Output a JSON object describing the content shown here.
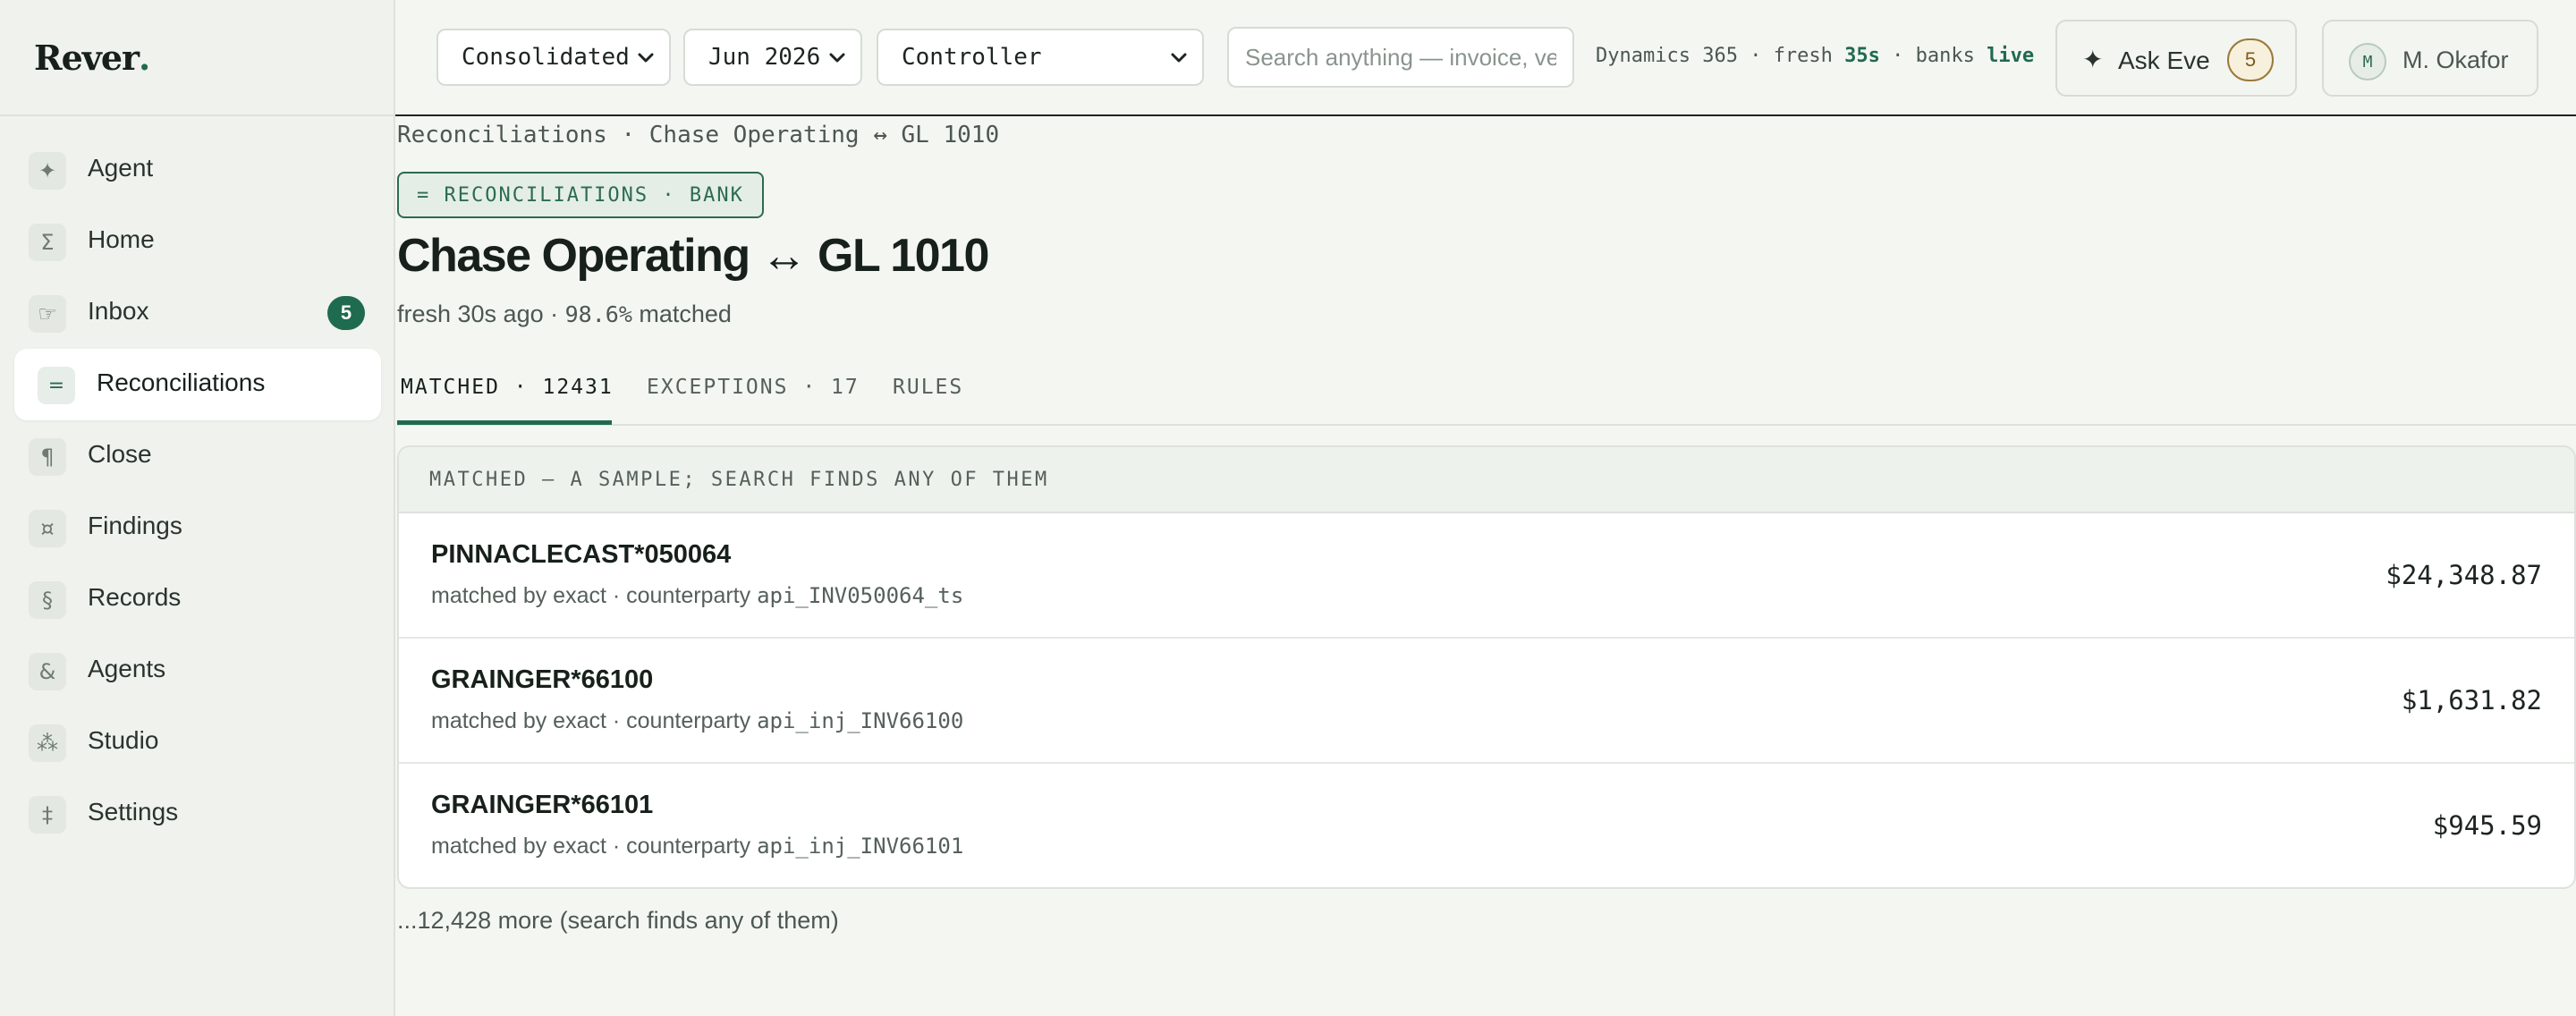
{
  "brand": {
    "name": "Rever",
    "dot": "."
  },
  "sidebar": {
    "items": [
      {
        "label": "Agent",
        "icon": "agent-icon",
        "glyph": "✦"
      },
      {
        "label": "Home",
        "icon": "sigma-icon",
        "glyph": "Σ"
      },
      {
        "label": "Inbox",
        "icon": "inbox-icon",
        "glyph": "☞",
        "badge": "5"
      },
      {
        "label": "Reconciliations",
        "icon": "equals-icon",
        "glyph": "=",
        "active": true
      },
      {
        "label": "Close",
        "icon": "pilcrow-icon",
        "glyph": "¶"
      },
      {
        "label": "Findings",
        "icon": "currency-icon",
        "glyph": "¤"
      },
      {
        "label": "Records",
        "icon": "section-icon",
        "glyph": "§"
      },
      {
        "label": "Agents",
        "icon": "ampersand-icon",
        "glyph": "&"
      },
      {
        "label": "Studio",
        "icon": "studio-icon",
        "glyph": "⁂"
      },
      {
        "label": "Settings",
        "icon": "double-dagger-icon",
        "glyph": "‡"
      }
    ]
  },
  "topbar": {
    "entity": "Consolidated",
    "period": "Jun 2026",
    "role": "Controller",
    "search_placeholder": "Search anything — invoice, vendor, rule",
    "status": {
      "system": "Dynamics 365",
      "sep1": " · fresh ",
      "fresh": "35s",
      "sep2": " · banks ",
      "banks": "live"
    },
    "ask_label": "Ask Eve",
    "ask_count": "5",
    "user_initial": "M",
    "user_name": "M. Okafor"
  },
  "main": {
    "breadcrumb": "Reconciliations · Chase Operating ↔ GL 1010",
    "kicker": "= RECONCILIATIONS · BANK",
    "title": "Chase Operating ↔ GL 1010",
    "fresh": "fresh 30s ago",
    "dot": " · ",
    "pct": "98.6%",
    "matched_word": " matched",
    "tabs": [
      {
        "label": "MATCHED · 12431",
        "active": true
      },
      {
        "label": "EXCEPTIONS · 17"
      },
      {
        "label": "RULES"
      }
    ],
    "panel_title": "MATCHED — A SAMPLE; SEARCH FINDS ANY OF THEM",
    "rows": [
      {
        "desc": "PINNACLECAST*050064",
        "method": "matched by exact",
        "cp_label": "counterparty ",
        "cp": "api_INV050064_ts",
        "amount": "$24,348.87"
      },
      {
        "desc": "GRAINGER*66100",
        "method": "matched by exact",
        "cp_label": "counterparty ",
        "cp": "api_inj_INV66100",
        "amount": "$1,631.82"
      },
      {
        "desc": "GRAINGER*66101",
        "method": "matched by exact",
        "cp_label": "counterparty ",
        "cp": "api_inj_INV66101",
        "amount": "$945.59"
      }
    ],
    "more": "...12,428 more (search finds any of them)"
  },
  "colors": {
    "accent": "#1f6b4f",
    "ask_badge": "#9a7a3a"
  }
}
